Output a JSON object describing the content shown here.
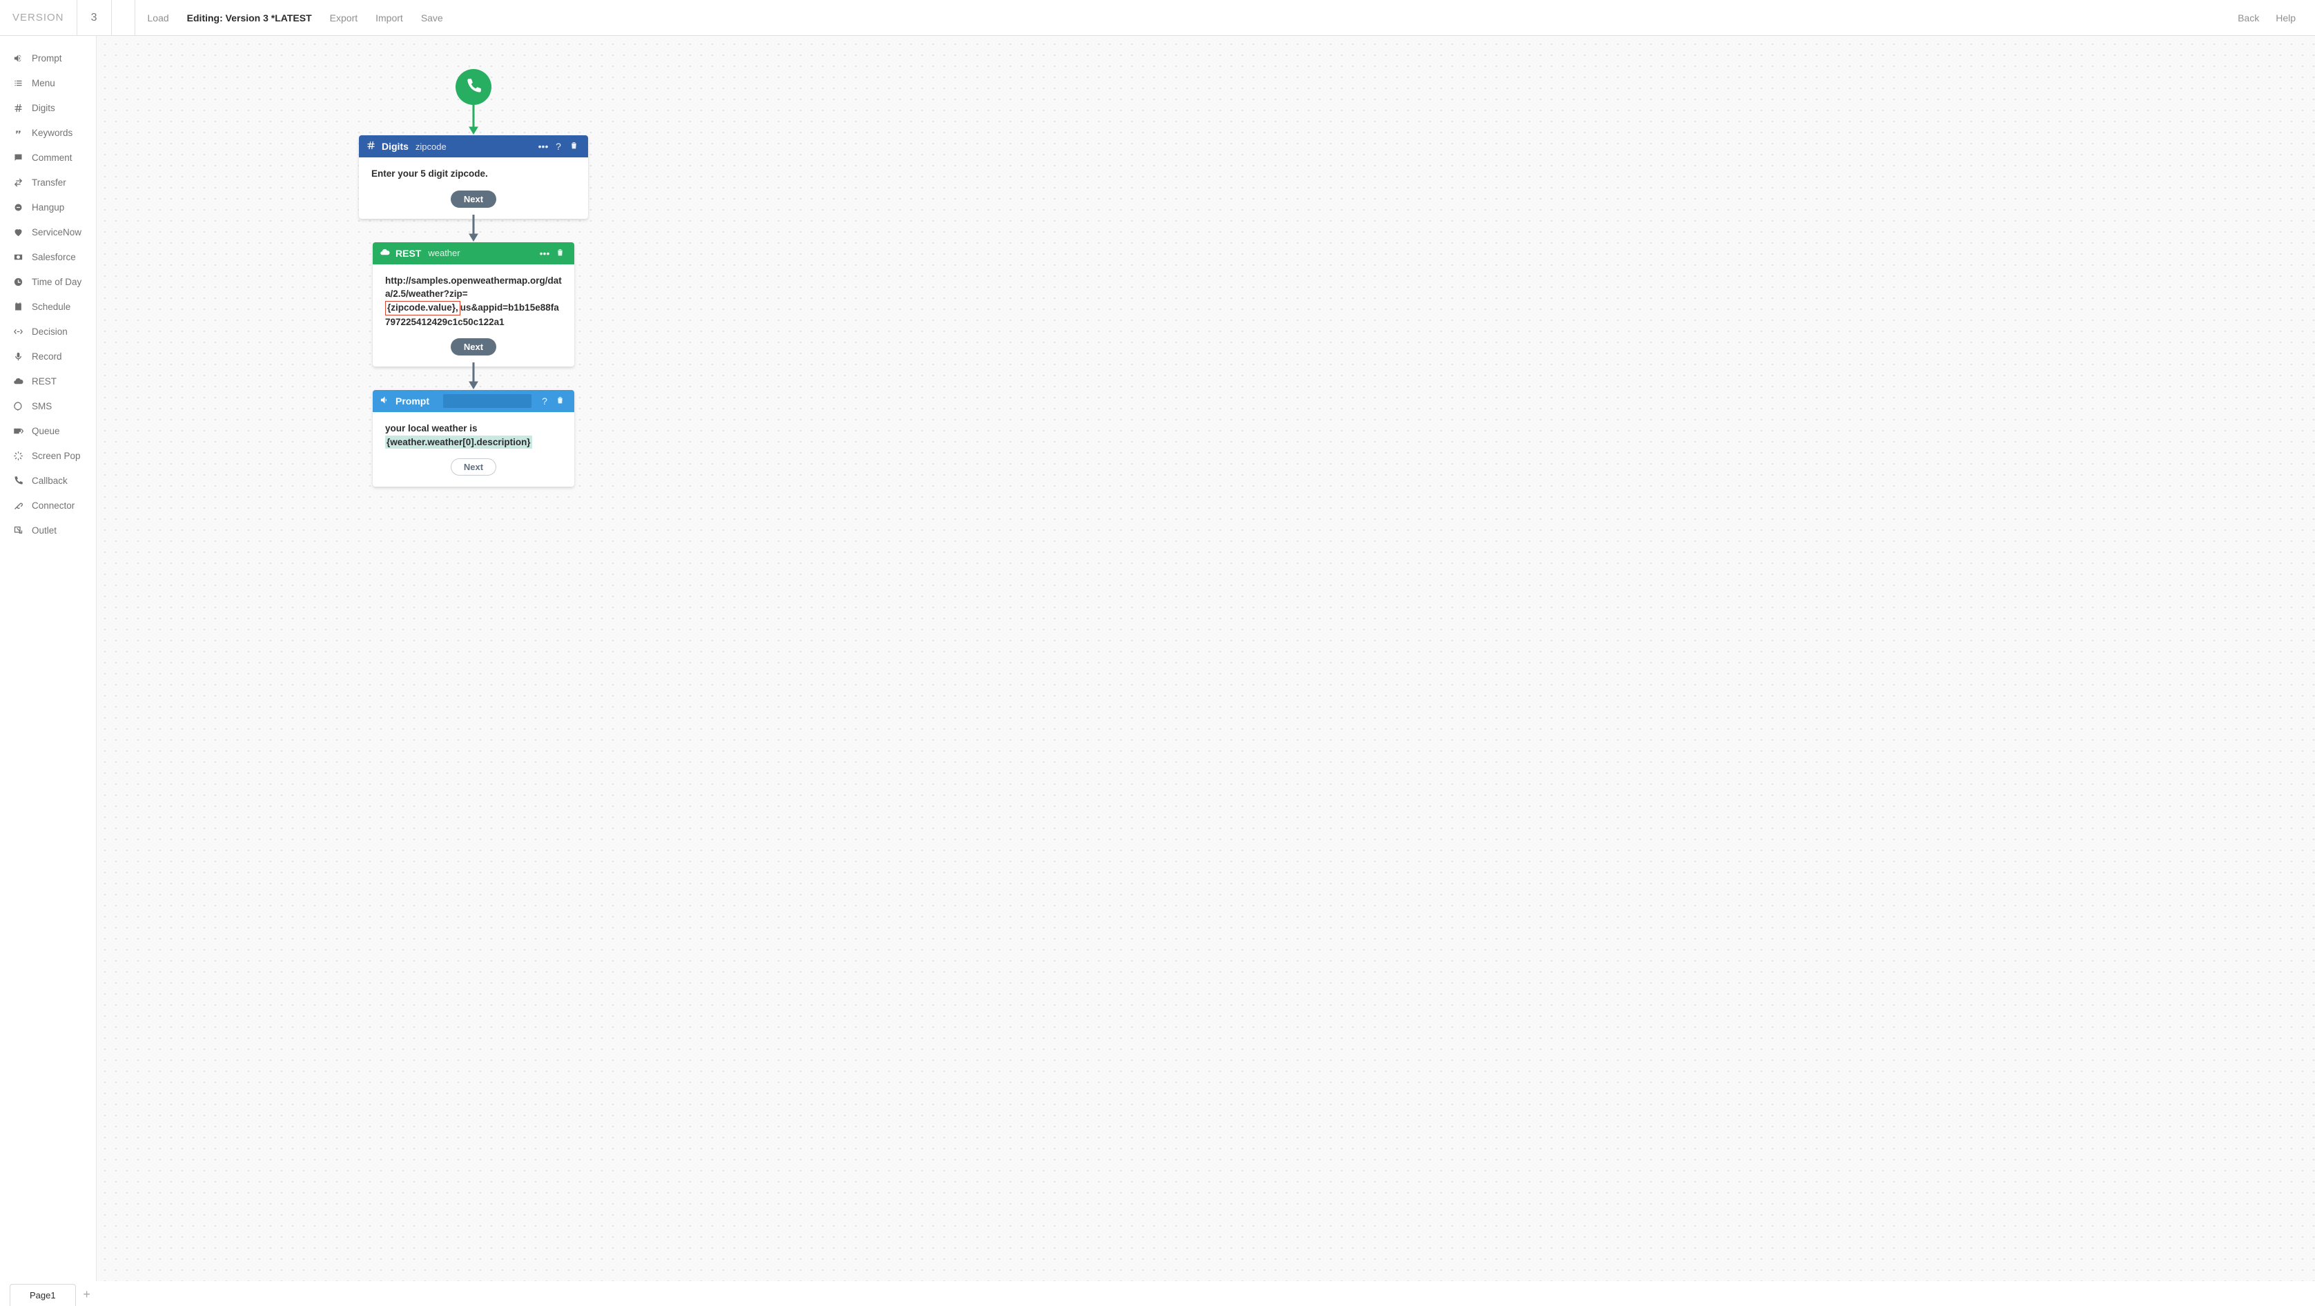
{
  "topbar": {
    "version_label": "VERSION",
    "version_number": "3",
    "load": "Load",
    "editing": "Editing: Version 3 *LATEST",
    "export": "Export",
    "import": "Import",
    "save": "Save",
    "back": "Back",
    "help": "Help"
  },
  "sidebar": [
    {
      "icon": "speaker-icon",
      "label": "Prompt"
    },
    {
      "icon": "list-icon",
      "label": "Menu"
    },
    {
      "icon": "hash-icon",
      "label": "Digits"
    },
    {
      "icon": "quote-icon",
      "label": "Keywords"
    },
    {
      "icon": "comment-icon",
      "label": "Comment"
    },
    {
      "icon": "transfer-icon",
      "label": "Transfer"
    },
    {
      "icon": "hangup-icon",
      "label": "Hangup"
    },
    {
      "icon": "heart-icon",
      "label": "ServiceNow"
    },
    {
      "icon": "money-icon",
      "label": "Salesforce"
    },
    {
      "icon": "clock-icon",
      "label": "Time of Day"
    },
    {
      "icon": "calendar-icon",
      "label": "Schedule"
    },
    {
      "icon": "decision-icon",
      "label": "Decision"
    },
    {
      "icon": "mic-icon",
      "label": "Record"
    },
    {
      "icon": "cloud-icon",
      "label": "REST"
    },
    {
      "icon": "sms-icon",
      "label": "SMS"
    },
    {
      "icon": "queue-icon",
      "label": "Queue"
    },
    {
      "icon": "pop-icon",
      "label": "Screen Pop"
    },
    {
      "icon": "phone-icon",
      "label": "Callback"
    },
    {
      "icon": "connector-icon",
      "label": "Connector"
    },
    {
      "icon": "outlet-icon",
      "label": "Outlet"
    }
  ],
  "nodes": {
    "digits": {
      "title": "Digits",
      "name": "zipcode",
      "body": "Enter your 5 digit zipcode.",
      "next": "Next"
    },
    "rest": {
      "title": "REST",
      "name": "weather",
      "url_a": "http://samples.openweathermap.org/data/2.5/weather?zip=",
      "url_var": "{zipcode.value},",
      "url_b": "us&appid=b1b15e88fa797225412429c1c50c122a1",
      "next": "Next"
    },
    "prompt": {
      "title": "Prompt",
      "body_a": "your local weather is",
      "body_var": "{weather.weather[0].description}",
      "next": "Next"
    }
  },
  "bottom": {
    "tab1": "Page1"
  }
}
